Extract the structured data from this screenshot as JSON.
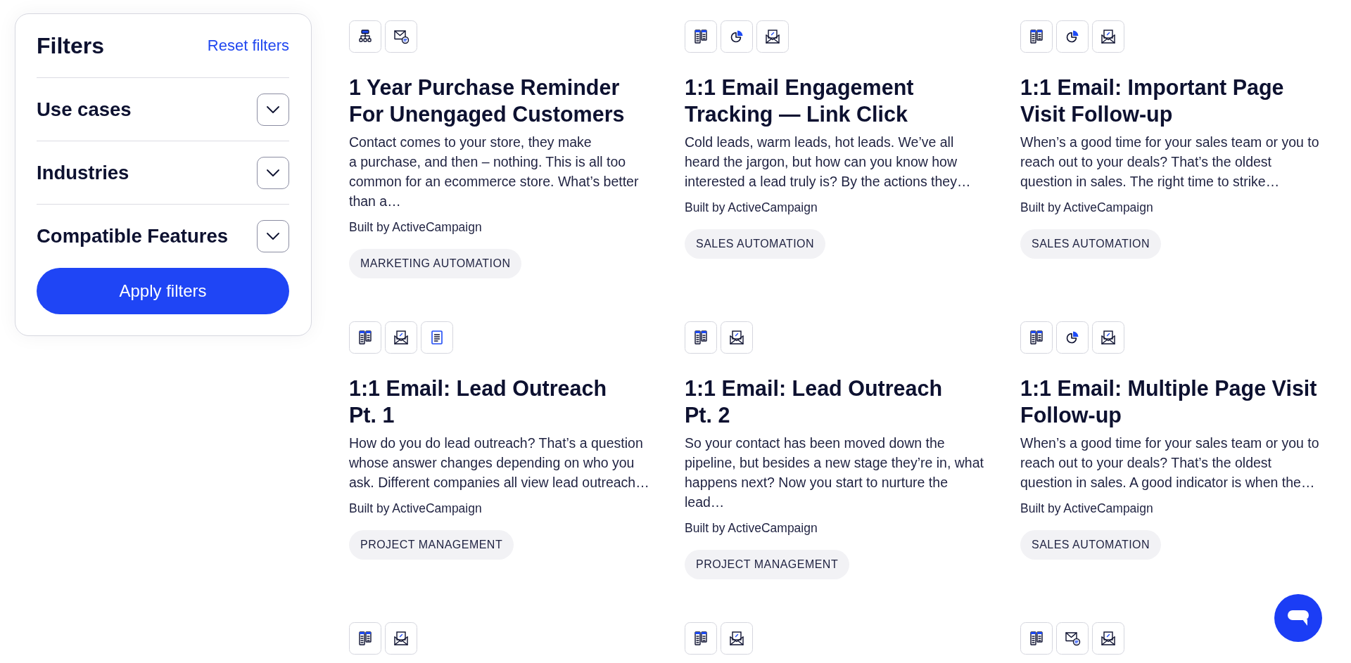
{
  "filters": {
    "title": "Filters",
    "reset_link": "Reset filters",
    "sections": [
      {
        "label": "Use cases",
        "expanded": false
      },
      {
        "label": "Industries",
        "expanded": false
      },
      {
        "label": "Compatible Features",
        "expanded": false
      }
    ],
    "apply_button": "Apply filters"
  },
  "templates": [
    {
      "features": [
        {
          "kind": "sitemap"
        },
        {
          "kind": "message"
        }
      ],
      "title": "1 Year Purchase Reminder For Unengaged Customers",
      "description": "Contact comes to your store, they make a purchase, and then – nothing. This is all too common for an ecommerce store. What’s better than a…",
      "author": "Built by ActiveCampaign",
      "tag": "MARKETING AUTOMATION"
    },
    {
      "features": [
        {
          "kind": "pipeline"
        },
        {
          "kind": "report"
        },
        {
          "kind": "email"
        }
      ],
      "title": "1:1 Email Engagement Tracking — Link Click",
      "description": "Cold leads, warm leads, hot leads. We’ve all heard the jargon, but how can you know how interested a lead truly is? By the actions they…",
      "author": "Built by ActiveCampaign",
      "tag": "SALES AUTOMATION"
    },
    {
      "features": [
        {
          "kind": "pipeline"
        },
        {
          "kind": "report"
        },
        {
          "kind": "email"
        }
      ],
      "title": "1:1 Email: Important Page Visit Follow-up",
      "description": "When’s a good time for your sales team or you to reach out to your deals? That’s the oldest question in sales. The right time to strike…",
      "author": "Built by ActiveCampaign",
      "tag": "SALES AUTOMATION"
    },
    {
      "features": [
        {
          "kind": "pipeline"
        },
        {
          "kind": "email"
        },
        {
          "kind": "page"
        }
      ],
      "title": "1:1 Email: Lead Outreach Pt. 1",
      "description": "How do you do lead outreach? That’s a question whose answer changes depending on who you ask. Different companies all view lead outreach…",
      "author": "Built by ActiveCampaign",
      "tag": "PROJECT MANAGEMENT"
    },
    {
      "features": [
        {
          "kind": "pipeline"
        },
        {
          "kind": "email"
        }
      ],
      "title": "1:1 Email: Lead Outreach Pt. 2",
      "description": "So your contact has been moved down the pipeline, but besides a new stage they’re in, what happens next? Now you start to nurture the lead…",
      "author": "Built by ActiveCampaign",
      "tag": "PROJECT MANAGEMENT"
    },
    {
      "features": [
        {
          "kind": "pipeline"
        },
        {
          "kind": "report"
        },
        {
          "kind": "email"
        }
      ],
      "title": "1:1 Email: Multiple Page Visit Follow-up",
      "description": "When’s a good time for your sales team or you to reach out to your deals? That’s the oldest question in sales. A good indicator is when the…",
      "author": "Built by ActiveCampaign",
      "tag": "SALES AUTOMATION"
    },
    {
      "features": [
        {
          "kind": "pipeline"
        },
        {
          "kind": "email"
        }
      ]
    },
    {
      "features": [
        {
          "kind": "pipeline"
        },
        {
          "kind": "email"
        }
      ]
    },
    {
      "features": [
        {
          "kind": "pipeline"
        },
        {
          "kind": "message"
        },
        {
          "kind": "email"
        }
      ]
    }
  ]
}
